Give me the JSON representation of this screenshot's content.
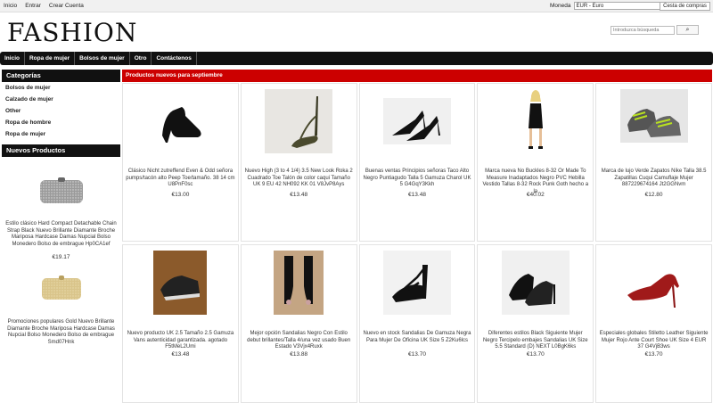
{
  "topbar": {
    "links": [
      "Inicio",
      "Entrar",
      "Crear Cuenta"
    ],
    "currency_label": "Moneda",
    "currency_value": "EUR - Euro",
    "cart_label": "Cesta de compras"
  },
  "logo": "FASHION",
  "search": {
    "placeholder": "Introduzca búsqueda"
  },
  "nav": [
    "Inicio",
    "Ropa de mujer",
    "Bolsos de mujer",
    "Otro",
    "Contáctenos"
  ],
  "sidebar": {
    "categories_title": "Categorías",
    "categories": [
      "Bolsos de mujer",
      "Calzado de mujer",
      "Other",
      "Ropa de hombre",
      "Ropa de mujer"
    ],
    "new_title": "Nuevos Productos",
    "new_products": [
      {
        "title": "Estilo clásico Hard Compact Detachable Chain Strap Black Nuevo Brillante Diamante Broche Mariposa Hardcase Damas Nupcial Bolso Monedero Bolso de embrague Hp0CA1ef",
        "price": "€19.17"
      },
      {
        "title": "Promociones populares Gold Nuevo Brillante Diamante Broche Mariposa Hardcase Damas Nupcial Bolso Monedero Bolso de embrague Smd07Hnk",
        "price": ""
      }
    ]
  },
  "main": {
    "title": "Productos nuevos para septiembre",
    "products": [
      {
        "title": "Clásico Nicht zutreffend Even & Odd señora pumps/tacón alto Peep Toe/tamaño. 38 14 cm U8PnF0sc",
        "price": "€13.00",
        "icon": "black-stiletto-pump"
      },
      {
        "title": "Nuevo High (3 to 4 1/4) 3.5 New Look Roka 2 Cuadrado Toe Talón de color caqui Tamaño UK 9 EU 42 NH092 KK 01 V8JvP8Ays",
        "price": "€13.48",
        "icon": "khaki-strappy-sandal"
      },
      {
        "title": "Buenas ventas Principios señoras Taco Alto Negro Puntiagudo Talla 5 Gamuza Charol UK 5 G4GqY3Kkh",
        "price": "€13.48",
        "icon": "black-pointed-heels"
      },
      {
        "title": "Marca nueva No Buckles 8-32 Or Made To Measure Inadaptados Negro PVC Hebilla Vestido Tallas 8-32 Rock Punk Goth hecho a la",
        "price": "€40.02",
        "icon": "black-pvc-dress"
      },
      {
        "title": "Marca de lujo Verde Zapatos Nike Talla 38.5 Zapatillas Cuqui Camuflaje Mujer 887229674164 Jt2GGNvm",
        "price": "€12.80",
        "icon": "green-sneakers"
      },
      {
        "title": "Nuevo producto UK 2.5 Tamaño 2.5 Gamuza Vans autenticidad garantizada. agotado F5tMeL2Umi",
        "price": "€13.48",
        "icon": "black-suede-shoe"
      },
      {
        "title": "Mejor opción Sandalias Negro Con Estilo debut brillantes/Talla 4/una vez usado Buen Estado V3Vjx4Ruxk",
        "price": "€13.88",
        "icon": "black-peep-toe-heels"
      },
      {
        "title": "Nuevo en stock Sandalias De Gamuza Negra Para Mujer De Oficina UK Size 5 Z2Ku6lcs",
        "price": "€13.70",
        "icon": "black-t-strap-sandal"
      },
      {
        "title": "Diferentes estilos Black Siguiente Mujer Negro Tercipelo embajes Sandalias UK Size 5.5 Standard (D) NEXT L0BgK6ks",
        "price": "€13.70",
        "icon": "black-velvet-sandals"
      },
      {
        "title": "Especiales globales Stiletto Leather Siguiente Mujer Rojo Ante Court Shoe UK Size 4 EUR 37 G4VjB3ws",
        "price": "€13.70",
        "icon": "red-suede-pump"
      }
    ]
  }
}
